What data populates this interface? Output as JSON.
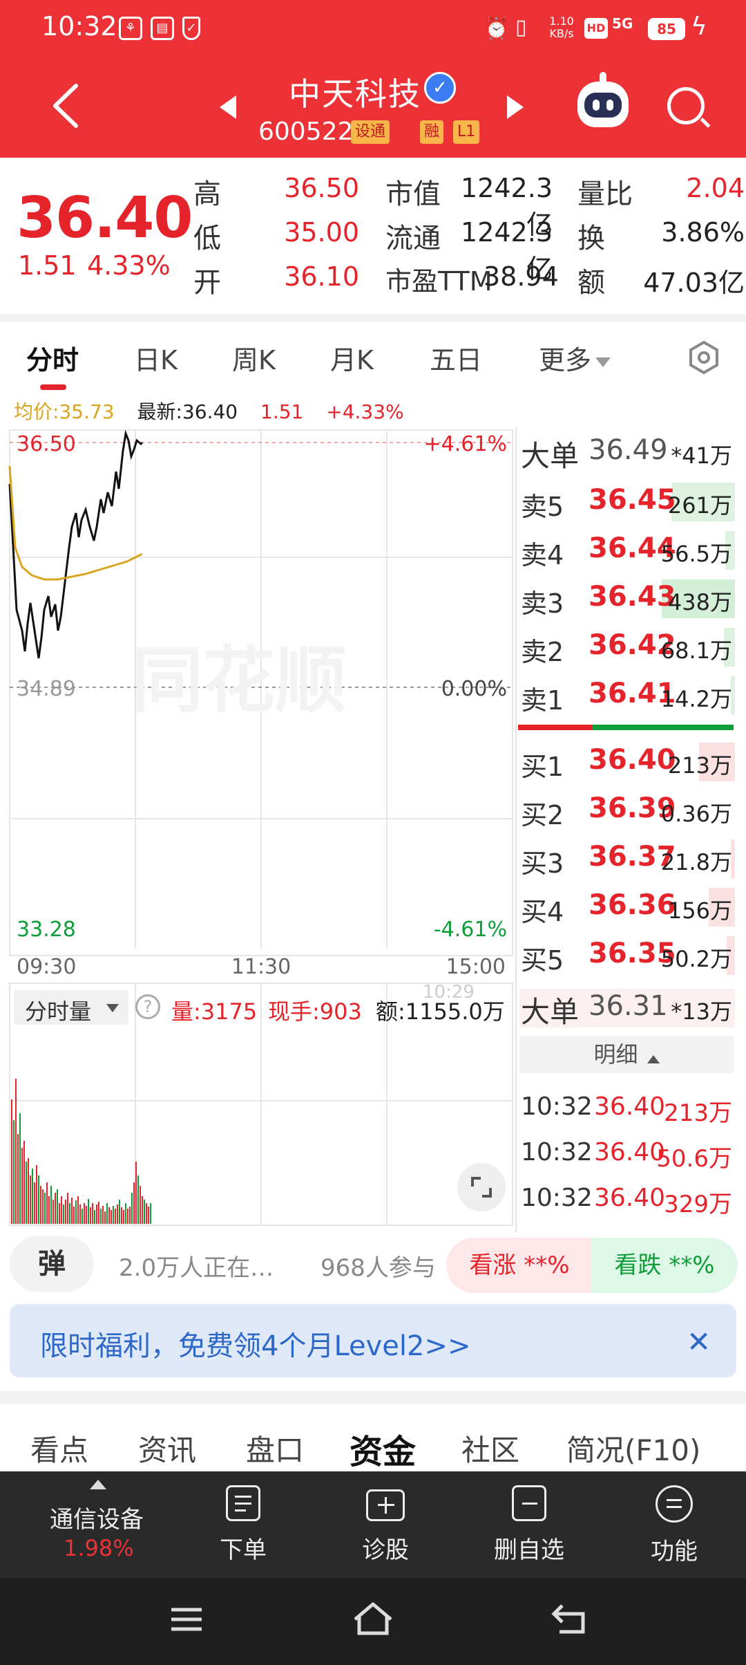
{
  "status_bar": {
    "time": "10:32",
    "net_speed": "1.10 KB/s",
    "hd": "HD",
    "signal": "5G",
    "battery": "85"
  },
  "header": {
    "stock_name": "中天科技",
    "verified_mark": "✓",
    "stock_code": "600522",
    "tags": [
      "设通",
      "融",
      "L1"
    ]
  },
  "quote": {
    "price": "36.40",
    "change": "1.51",
    "change_pct": "4.33%",
    "rows": [
      {
        "l1": "高",
        "v1": "36.50",
        "l2": "市值",
        "v2": "1242.3亿",
        "l3": "量比",
        "v3": "2.04"
      },
      {
        "l1": "低",
        "v1": "35.00",
        "l2": "流通",
        "v2": "1242.3亿",
        "l3": "换",
        "v3": "3.86%"
      },
      {
        "l1": "开",
        "v1": "36.10",
        "l2": "市盈TTM",
        "v2": "38.94",
        "l3": "额",
        "v3": "47.03亿"
      }
    ]
  },
  "period_tabs": [
    "分时",
    "日K",
    "周K",
    "月K",
    "五日",
    "更多"
  ],
  "intraday": {
    "avg_label": "均价:35.73",
    "latest_label": "最新:36.40",
    "change": "1.51",
    "change_pct": "+4.33%",
    "y_high": "36.50",
    "y_mid": "34.89",
    "y_low": "33.28",
    "pct_high": "+4.61%",
    "pct_mid": "0.00%",
    "pct_low": "-4.61%",
    "times": [
      "09:30",
      "11:30",
      "15:00"
    ],
    "watermark": "同花顺"
  },
  "volume_panel": {
    "selector": "分时量",
    "help": "?",
    "vol": "量:3175",
    "cur_hand": "现手:903",
    "amount": "额:1155.0万",
    "overlay_time": "10:29"
  },
  "order_book": {
    "big_top": {
      "label": "大单",
      "price": "36.49",
      "vol": "*41万"
    },
    "asks": [
      {
        "label": "卖5",
        "price": "36.45",
        "vol": "261万"
      },
      {
        "label": "卖4",
        "price": "36.44",
        "vol": "56.5万"
      },
      {
        "label": "卖3",
        "price": "36.43",
        "vol": "438万"
      },
      {
        "label": "卖2",
        "price": "36.42",
        "vol": "68.1万"
      },
      {
        "label": "卖1",
        "price": "36.41",
        "vol": "14.2万"
      }
    ],
    "bids": [
      {
        "label": "买1",
        "price": "36.40",
        "vol": "213万"
      },
      {
        "label": "买2",
        "price": "36.39",
        "vol": "0.36万"
      },
      {
        "label": "买3",
        "price": "36.37",
        "vol": "21.8万"
      },
      {
        "label": "买4",
        "price": "36.36",
        "vol": "156万"
      },
      {
        "label": "买5",
        "price": "36.35",
        "vol": "50.2万"
      }
    ],
    "big_bottom": {
      "label": "大单",
      "price": "36.31",
      "vol": "*13万"
    },
    "detail_label": "明细",
    "trades": [
      {
        "time": "10:32",
        "price": "36.40",
        "vol": "213万"
      },
      {
        "time": "10:32",
        "price": "36.40",
        "vol": "50.6万"
      },
      {
        "time": "10:32",
        "price": "36.40",
        "vol": "329万"
      }
    ]
  },
  "vote": {
    "danmu": "弹",
    "watching": "2.0万人正在…",
    "joined": "968人参与",
    "up": "看涨 **%",
    "down": "看跌 **%"
  },
  "promo": {
    "text": "限时福利，免费领4个月Level2>>",
    "close": "✕"
  },
  "info_tabs": [
    "看点",
    "资讯",
    "盘口",
    "资金",
    "社区",
    "简况(F10)"
  ],
  "toolbar": {
    "sector": "通信设备",
    "sector_pct": "1.98%",
    "items": [
      "下单",
      "诊股",
      "删自选",
      "功能"
    ]
  },
  "colors": {
    "brand_red": "#ec3237",
    "up": "#e4232b",
    "down": "#0f9d3a",
    "avg_line": "#d9a520"
  }
}
